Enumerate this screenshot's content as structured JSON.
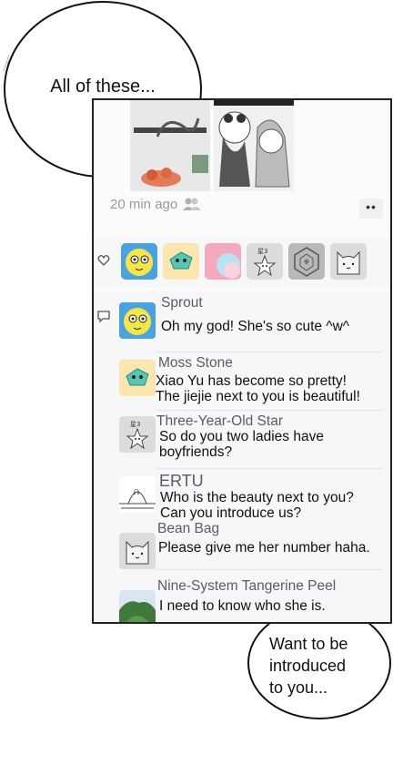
{
  "narration": {
    "top_bubble": "All of these...",
    "bottom_bubble": "Want to be\nintroduced\nto you..."
  },
  "post": {
    "time": "20 min ago",
    "time_icon": "friends-visibility-icon",
    "more_label": "••"
  },
  "likes": [
    "Sprout",
    "Moss Stone",
    "Pink Avatar",
    "Three-Year-Old Star",
    "Geometric Avatar",
    "Bean Bag"
  ],
  "comments": [
    {
      "name": "Sprout",
      "text": "Oh my god! She's so cute ^w^"
    },
    {
      "name": "Moss Stone",
      "text": "Xiao Yu has become so pretty!\nThe jiejie next to you is beautiful!"
    },
    {
      "name": "Three-Year-Old Star",
      "text": "So do you two ladies have\nboyfriends?"
    },
    {
      "name": "ERTU",
      "text": "Who is the beauty next to you?\nCan you introduce us?"
    },
    {
      "name": "Bean Bag",
      "text": "Please give me her number haha."
    },
    {
      "name": "Nine-System Tangerine Peel",
      "text": "I need to know who she is."
    }
  ],
  "colors": {
    "name_text": "#5b5b66",
    "timestamp": "#9a9a9a",
    "comment_bg": "#f6f7f8"
  }
}
